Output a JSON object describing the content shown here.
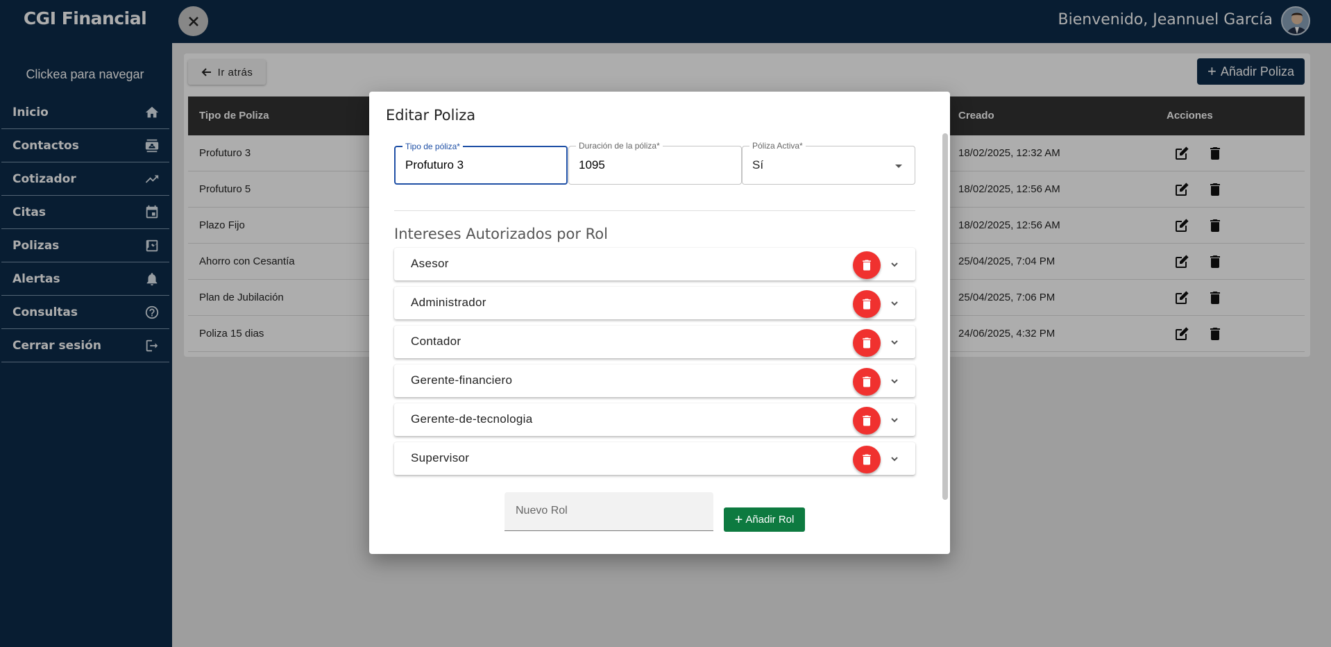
{
  "app": {
    "brand": "CGI Financial",
    "nav_hint": "Clickea para navegar"
  },
  "sidebar": {
    "items": [
      {
        "label": "Inicio",
        "icon": "home-icon"
      },
      {
        "label": "Contactos",
        "icon": "contact-card-icon"
      },
      {
        "label": "Cotizador",
        "icon": "trending-up-icon"
      },
      {
        "label": "Citas",
        "icon": "calendar-icon"
      },
      {
        "label": "Polizas",
        "icon": "chart-icon"
      },
      {
        "label": "Alertas",
        "icon": "bell-icon"
      },
      {
        "label": "Consultas",
        "icon": "help-circle-icon"
      },
      {
        "label": "Cerrar sesión",
        "icon": "logout-icon"
      }
    ]
  },
  "header": {
    "welcome": "Bienvenido, Jeannuel García"
  },
  "page": {
    "back_label": "Ir atrás",
    "add_poliza_label": "Añadir Poliza",
    "table": {
      "headers": {
        "tipo": "Tipo de Poliza",
        "creado": "Creado",
        "acciones": "Acciones"
      },
      "rows": [
        {
          "tipo": "Profuturo 3",
          "creado": "18/02/2025, 12:32 AM"
        },
        {
          "tipo": "Profuturo 5",
          "creado": "18/02/2025, 12:56 AM"
        },
        {
          "tipo": "Plazo Fijo",
          "creado": "18/02/2025, 12:56 AM"
        },
        {
          "tipo": "Ahorro con Cesantía",
          "creado": "25/04/2025, 7:04 PM"
        },
        {
          "tipo": "Plan de Jubilación",
          "creado": "25/04/2025, 7:06 PM"
        },
        {
          "tipo": "Poliza 15 dias",
          "creado": "24/06/2025, 4:32 PM"
        }
      ]
    }
  },
  "dialog": {
    "title": "Editar Poliza",
    "fields": {
      "tipo": {
        "label": "Tipo de póliza*",
        "value": "Profuturo 3"
      },
      "duracion": {
        "label": "Duración de la póliza*",
        "value": "1095"
      },
      "activa": {
        "label": "Póliza Activa*",
        "value": "Sí"
      }
    },
    "section_title": "Intereses Autorizados por Rol",
    "roles": [
      "Asesor",
      "Administrador",
      "Contador",
      "Gerente-financiero",
      "Gerente-de-tecnologia",
      "Supervisor"
    ],
    "new_role_placeholder": "Nuevo Rol",
    "add_role_label": "Añadir Rol"
  },
  "colors": {
    "navy": "#0c2b4a",
    "delete_red": "#f0312f",
    "add_green": "#0d7a40",
    "focus_blue": "#1e4fa5"
  }
}
